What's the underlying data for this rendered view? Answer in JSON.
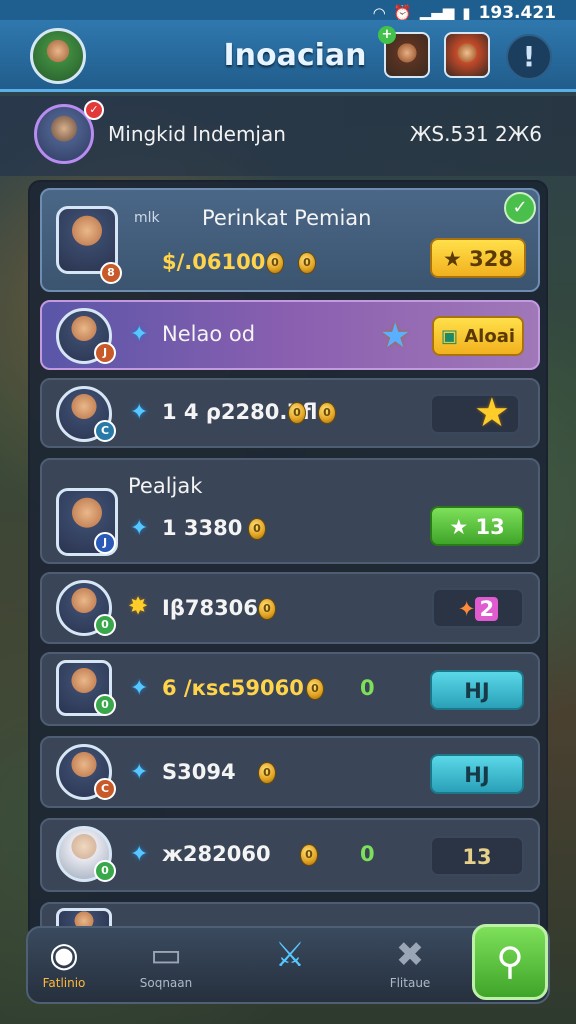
{
  "status_bar": {
    "time": "193.421",
    "icons": [
      "wifi-icon",
      "alarm-icon",
      "signal-icon",
      "battery-icon"
    ]
  },
  "header": {
    "title": "Inoacian",
    "info_label": "!"
  },
  "player": {
    "name": "Mingkid Indemjan",
    "score": "ЖS.531 2Ж6"
  },
  "leaderboard": {
    "rows": [
      {
        "name": "Perinkat Pemian",
        "prefix": "mlk",
        "value": "$/.06100",
        "pill": "328",
        "pill_style": "yellow"
      },
      {
        "name": "Nelao od",
        "action": "Aloai"
      },
      {
        "value": "1 4 ρ2280.7fl"
      },
      {
        "name": "Pealjak",
        "value": "1 3380",
        "pill": "13",
        "pill_style": "green"
      },
      {
        "value": "Iβ78306",
        "pill": "2",
        "pill_style": "purple"
      },
      {
        "value": "6 /кsc59060",
        "extra": "0",
        "pill": "HJ",
        "pill_style": "teal"
      },
      {
        "value": "S3094",
        "pill": "HJ",
        "pill_style": "teal"
      },
      {
        "value": "ж282060",
        "extra": "0",
        "pill": "13",
        "pill_style": "dark"
      }
    ]
  },
  "nav": {
    "items": [
      {
        "label": "Fatlinio",
        "icon": "target-icon"
      },
      {
        "label": "Soqnaan",
        "icon": "tablet-icon"
      },
      {
        "label": "",
        "icon": "sword-icon"
      },
      {
        "label": "Flitaue",
        "icon": "tools-icon"
      }
    ],
    "fab_icon": "pin-icon"
  },
  "colors": {
    "header": "#2f78ae",
    "accent_green": "#3fa52a",
    "accent_yellow": "#f2b11f",
    "accent_teal": "#2aa0b8"
  }
}
